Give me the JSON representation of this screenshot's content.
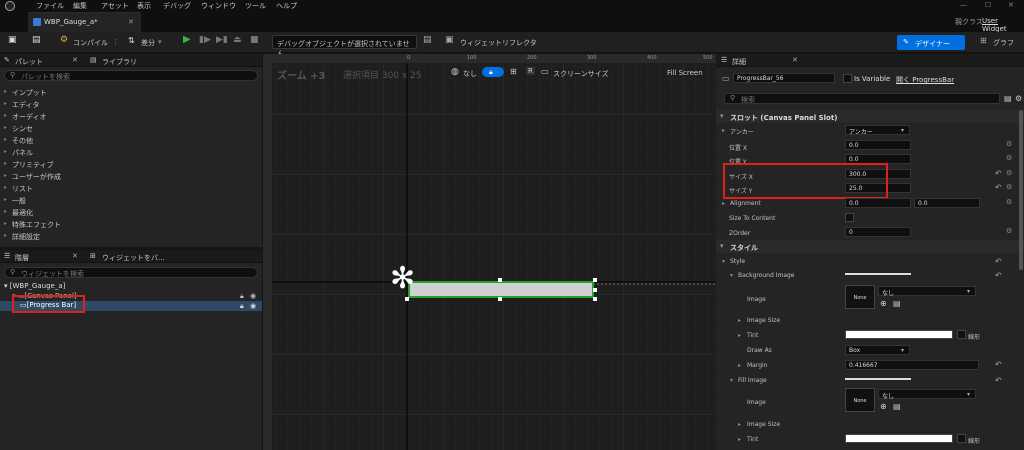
{
  "menu": [
    "ファイル",
    "編集",
    "アセット",
    "表示",
    "デバッグ",
    "ウィンドウ",
    "ツール",
    "ヘルプ"
  ],
  "tab": {
    "title": "WBP_Gauge_a*",
    "parent_label": "親クラス",
    "parent_value": "User Widget"
  },
  "toolbar": {
    "compile": "コンパイル",
    "diff": "差分",
    "debug_object": "デバッグオブジェクトが選択されていません",
    "widget_reflector": "ウィジェットリフレクタ",
    "designer": "デザイナー",
    "graph": "グラフ"
  },
  "palette": {
    "tab_palette": "パレット",
    "tab_library": "ライブラリ",
    "search_placeholder": "パレットを検索",
    "items": [
      "インプット",
      "エディタ",
      "オーディオ",
      "シンセ",
      "その他",
      "パネル",
      "プリミティブ",
      "ユーザーが作成",
      "リスト",
      "一般",
      "最適化",
      "特殊エフェクト",
      "詳細設定"
    ]
  },
  "hierarchy": {
    "tab_hierarchy": "階層",
    "tab_bind": "ウィジェットをバ...",
    "search_placeholder": "ウィジェットを検索",
    "root": "[WBP_Gauge_a]",
    "canvas": "[Canvas Panel]",
    "progress": "[Progress Bar]"
  },
  "canvas": {
    "zoom": "ズーム +3",
    "selection": "選択項目 300 x 25",
    "none_label": "なし",
    "r_label": "R",
    "screen_size": "スクリーンサイズ",
    "fill_screen": "Fill Screen",
    "ruler_ticks": [
      "0",
      "100",
      "200",
      "300",
      "400",
      "500",
      "600"
    ]
  },
  "details": {
    "title": "詳細",
    "widget_name": "ProgressBar_56",
    "is_variable": "Is Variable",
    "open_link": "開く ProgressBar",
    "search_placeholder": "検索",
    "slot_section": "スロット (Canvas Panel Slot)",
    "anchor_label": "アンカー",
    "anchor_value": "アンカー",
    "pos_x_label": "位置 X",
    "pos_x": "0.0",
    "pos_y_label": "位置 Y",
    "pos_y": "0.0",
    "size_x_label": "サイズ X",
    "size_x": "300.0",
    "size_y_label": "サイズ Y",
    "size_y": "25.0",
    "alignment_label": "Alignment",
    "align_x": "0.0",
    "align_y": "0.0",
    "size_to_content": "Size To Content",
    "zorder_label": "ZOrder",
    "zorder": "0",
    "style_section": "スタイル",
    "style_label": "Style",
    "bg_image": "Background Image",
    "image_label": "Image",
    "image_none": "None",
    "image_select": "なし",
    "image_size": "Image Size",
    "tint": "Tint",
    "tint_value": "線形",
    "draw_as": "Draw As",
    "draw_as_value": "Box",
    "margin": "Margin",
    "margin_value": "0.416667",
    "fill_image": "Fill Image"
  },
  "colors": {
    "accent": "#0070e0",
    "highlight": "#e0201c",
    "bar_outline": "#1fa52a"
  }
}
